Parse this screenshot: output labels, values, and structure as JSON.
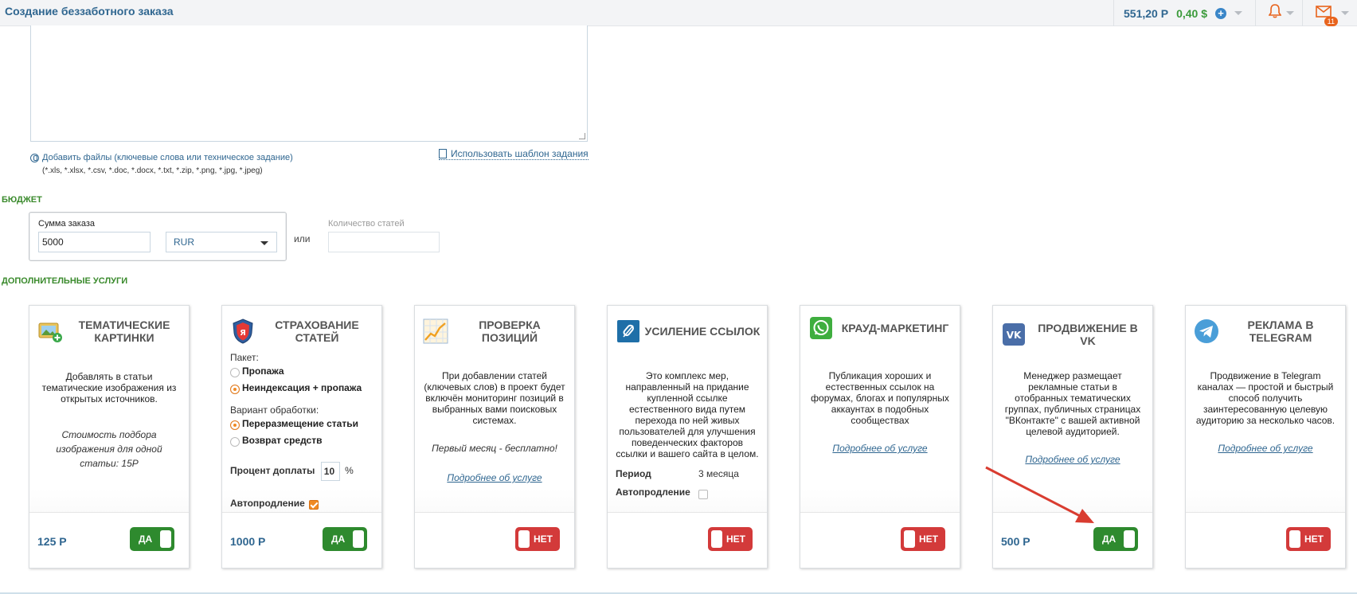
{
  "header": {
    "title": "Создание беззаботного заказа",
    "balance_rub": "551,20 Р",
    "balance_usd": "0,40 $",
    "mail_count": "11"
  },
  "files": {
    "add_label": "Добавить файлы (ключевые слова или техническое задание)",
    "types": "(*.xls, *.xlsx, *.csv, *.doc, *.docx, *.txt, *.zip, *.png, *.jpg, *.jpeg)",
    "template_label": "Использовать шаблон задания"
  },
  "budget": {
    "section_title": "БЮДЖЕТ",
    "sum_label": "Сумма заказа",
    "sum_value": "5000",
    "currency": "RUR",
    "or_label": "или",
    "count_label": "Количество статей",
    "count_value": ""
  },
  "services": {
    "section_title": "ДОПОЛНИТЕЛЬНЫЕ УСЛУГИ",
    "cards": [
      {
        "title": "Тематические картинки",
        "desc": "Добавлять в статьи тематические изображения из открытых источников.",
        "note": "Стоимость подбора изображения для одной статьи: 15Р",
        "price": "125 Р",
        "toggle": "ДА",
        "toggle_on": true
      },
      {
        "title": "Страхование статей",
        "package_label": "Пакет:",
        "package_options": [
          "Пропажа",
          "Неиндексация + пропажа"
        ],
        "package_selected": 1,
        "variant_label": "Вариант обработки:",
        "variant_options": [
          "Переразмещение статьи",
          "Возврат средств"
        ],
        "variant_selected": 0,
        "percent_label": "Процент доплаты",
        "percent_value": "10",
        "percent_unit": "%",
        "autorenew_label": "Автопродление",
        "autorenew": true,
        "price": "1000 Р",
        "toggle": "ДА",
        "toggle_on": true
      },
      {
        "title": "Проверка позиций",
        "desc": "При добавлении статей (ключевых слов) в проект будет включён мониторинг позиций в выбранных вами поисковых системах.",
        "note": "Первый месяц - бесплатно!",
        "link": "Подробнее об услуге",
        "toggle": "НЕТ",
        "toggle_on": false
      },
      {
        "title": "Усиление ссылок",
        "desc": "Это комплекс мер, направленный на придание купленной ссылке естественного вида путем перехода по ней живых пользователей для улучшения поведенческих факторов ссылки и вашего сайта в целом.",
        "period_label": "Период",
        "period_value": "3 месяца",
        "autorenew_label": "Автопродление",
        "autorenew": false,
        "toggle": "НЕТ",
        "toggle_on": false
      },
      {
        "title": "Крауд-маркетинг",
        "desc": "Публикация хороших и естественных ссылок на форумах, блогах и популярных аккаунтах в подобных сообществах",
        "link": "Подробнее об услуге",
        "toggle": "НЕТ",
        "toggle_on": false
      },
      {
        "title": "Продвижение в VK",
        "desc": "Менеджер размещает рекламные статьи в отобранных тематических группах, публичных страницах \"ВКонтакте\" с вашей активной целевой аудиторией.",
        "link": "Подробнее об услуге",
        "price": "500 Р",
        "toggle": "ДА",
        "toggle_on": true
      },
      {
        "title": "Реклама в Telegram",
        "desc": "Продвижение в Telegram каналах — простой и быстрый способ получить заинтересованную целевую аудиторию за несколько часов.",
        "link": "Подробнее об услуге",
        "toggle": "НЕТ",
        "toggle_on": false
      }
    ]
  },
  "colors": {
    "accent_blue": "#2f6690",
    "green": "#2e8a2e",
    "red": "#d33a3a",
    "orange": "#f08a24",
    "arrow_red": "#d93c30"
  }
}
